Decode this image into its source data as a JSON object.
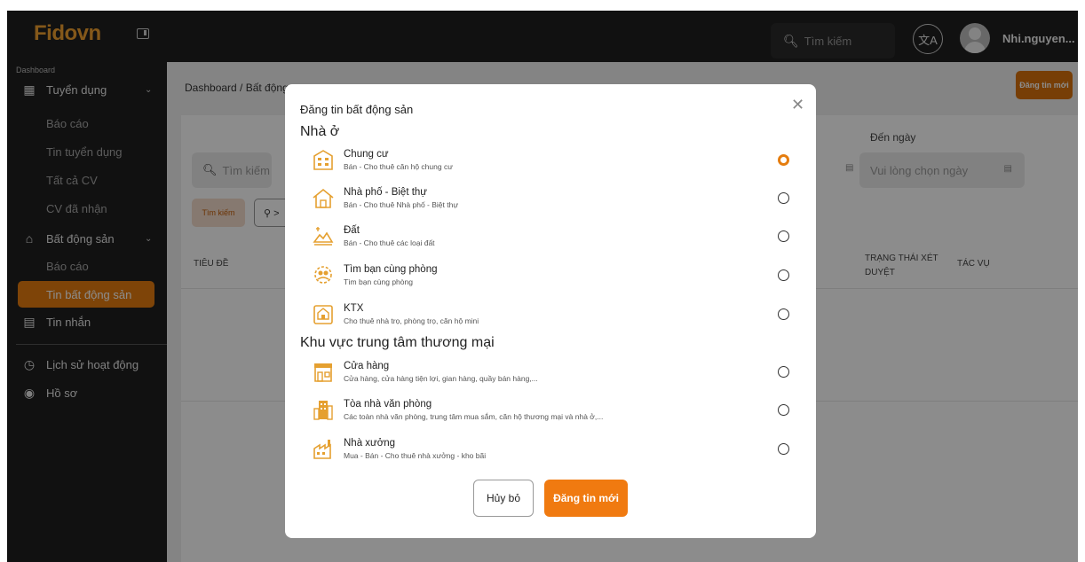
{
  "app": {
    "logo": "Fidovn",
    "accent_color": "#e57d0f",
    "topbar_color": "#1f1f1f"
  },
  "topbar": {
    "search_placeholder": "Tìm kiếm",
    "search_icon": "search-icon",
    "language_icon": "translate-icon",
    "username": "Nhi.nguyen..."
  },
  "sidebar": {
    "section": "Dashboard",
    "groups": [
      {
        "label": "Tuyển dụng",
        "icon": "building-icon",
        "items": [
          "Báo cáo",
          "Tin tuyển dụng",
          "Tất cả CV",
          "CV đã nhận"
        ]
      },
      {
        "label": "Bất động sản",
        "icon": "house-icon",
        "items": [
          "Báo cáo",
          "Tin bất động sản"
        ]
      }
    ],
    "messages": "Tin nhắn",
    "history": "Lịch sử hoạt động",
    "profile": "Hồ sơ",
    "active_item": "Tin bất động sản"
  },
  "main": {
    "breadcrumb": "Dashboard  /  Bất động s",
    "post_new_button": "Đăng tin mới",
    "search_placeholder": "Tìm kiếm",
    "to_date_label": "Đến ngày",
    "to_date_placeholder": "Vui lòng chọn ngày",
    "search_button": "Tìm kiếm",
    "filter_label": "⚲ >",
    "table_headers": {
      "title": "TIÊU ĐỀ",
      "status": "TRẠNG THÁI XÉT DUYỆT",
      "actions": "TÁC VỤ"
    }
  },
  "modal": {
    "title": "Đăng tin bất động sản",
    "groups": [
      {
        "title": "Nhà ở",
        "options": [
          {
            "name": "Chung cư",
            "desc": "Bán - Cho thuê căn hộ chung cư",
            "icon": "apartment-icon",
            "selected": true
          },
          {
            "name": "Nhà phố - Biệt thự",
            "desc": "Bán - Cho thuê Nhà phố - Biệt thự",
            "icon": "villa-icon",
            "selected": false
          },
          {
            "name": "Đất",
            "desc": "Bán - Cho thuê các loại đất",
            "icon": "land-icon",
            "selected": false
          },
          {
            "name": "Tìm bạn cùng phòng",
            "desc": "Tìm bạn cùng phòng",
            "icon": "roommate-icon",
            "selected": false
          },
          {
            "name": "KTX",
            "desc": "Cho thuê nhà trọ, phòng trọ, căn hộ mini",
            "icon": "dormitory-icon",
            "selected": false
          }
        ]
      },
      {
        "title": "Khu vực trung tâm thương mại",
        "options": [
          {
            "name": "Cửa hàng",
            "desc": "Cửa hàng, cửa hàng tiện lợi, gian hàng, quầy bán hàng,...",
            "icon": "shop-icon",
            "selected": false
          },
          {
            "name": "Tòa nhà văn phòng",
            "desc": "Các toàn nhà văn phòng, trung tâm mua sắm, căn hộ thương mại và nhà ở,...",
            "icon": "office-building-icon",
            "selected": false
          },
          {
            "name": "Nhà xưởng",
            "desc": "Mua - Bán - Cho thuê nhà xưởng - kho bãi",
            "icon": "factory-icon",
            "selected": false
          }
        ]
      }
    ],
    "cancel_button": "Hủy bỏ",
    "submit_button": "Đăng tin mới"
  }
}
